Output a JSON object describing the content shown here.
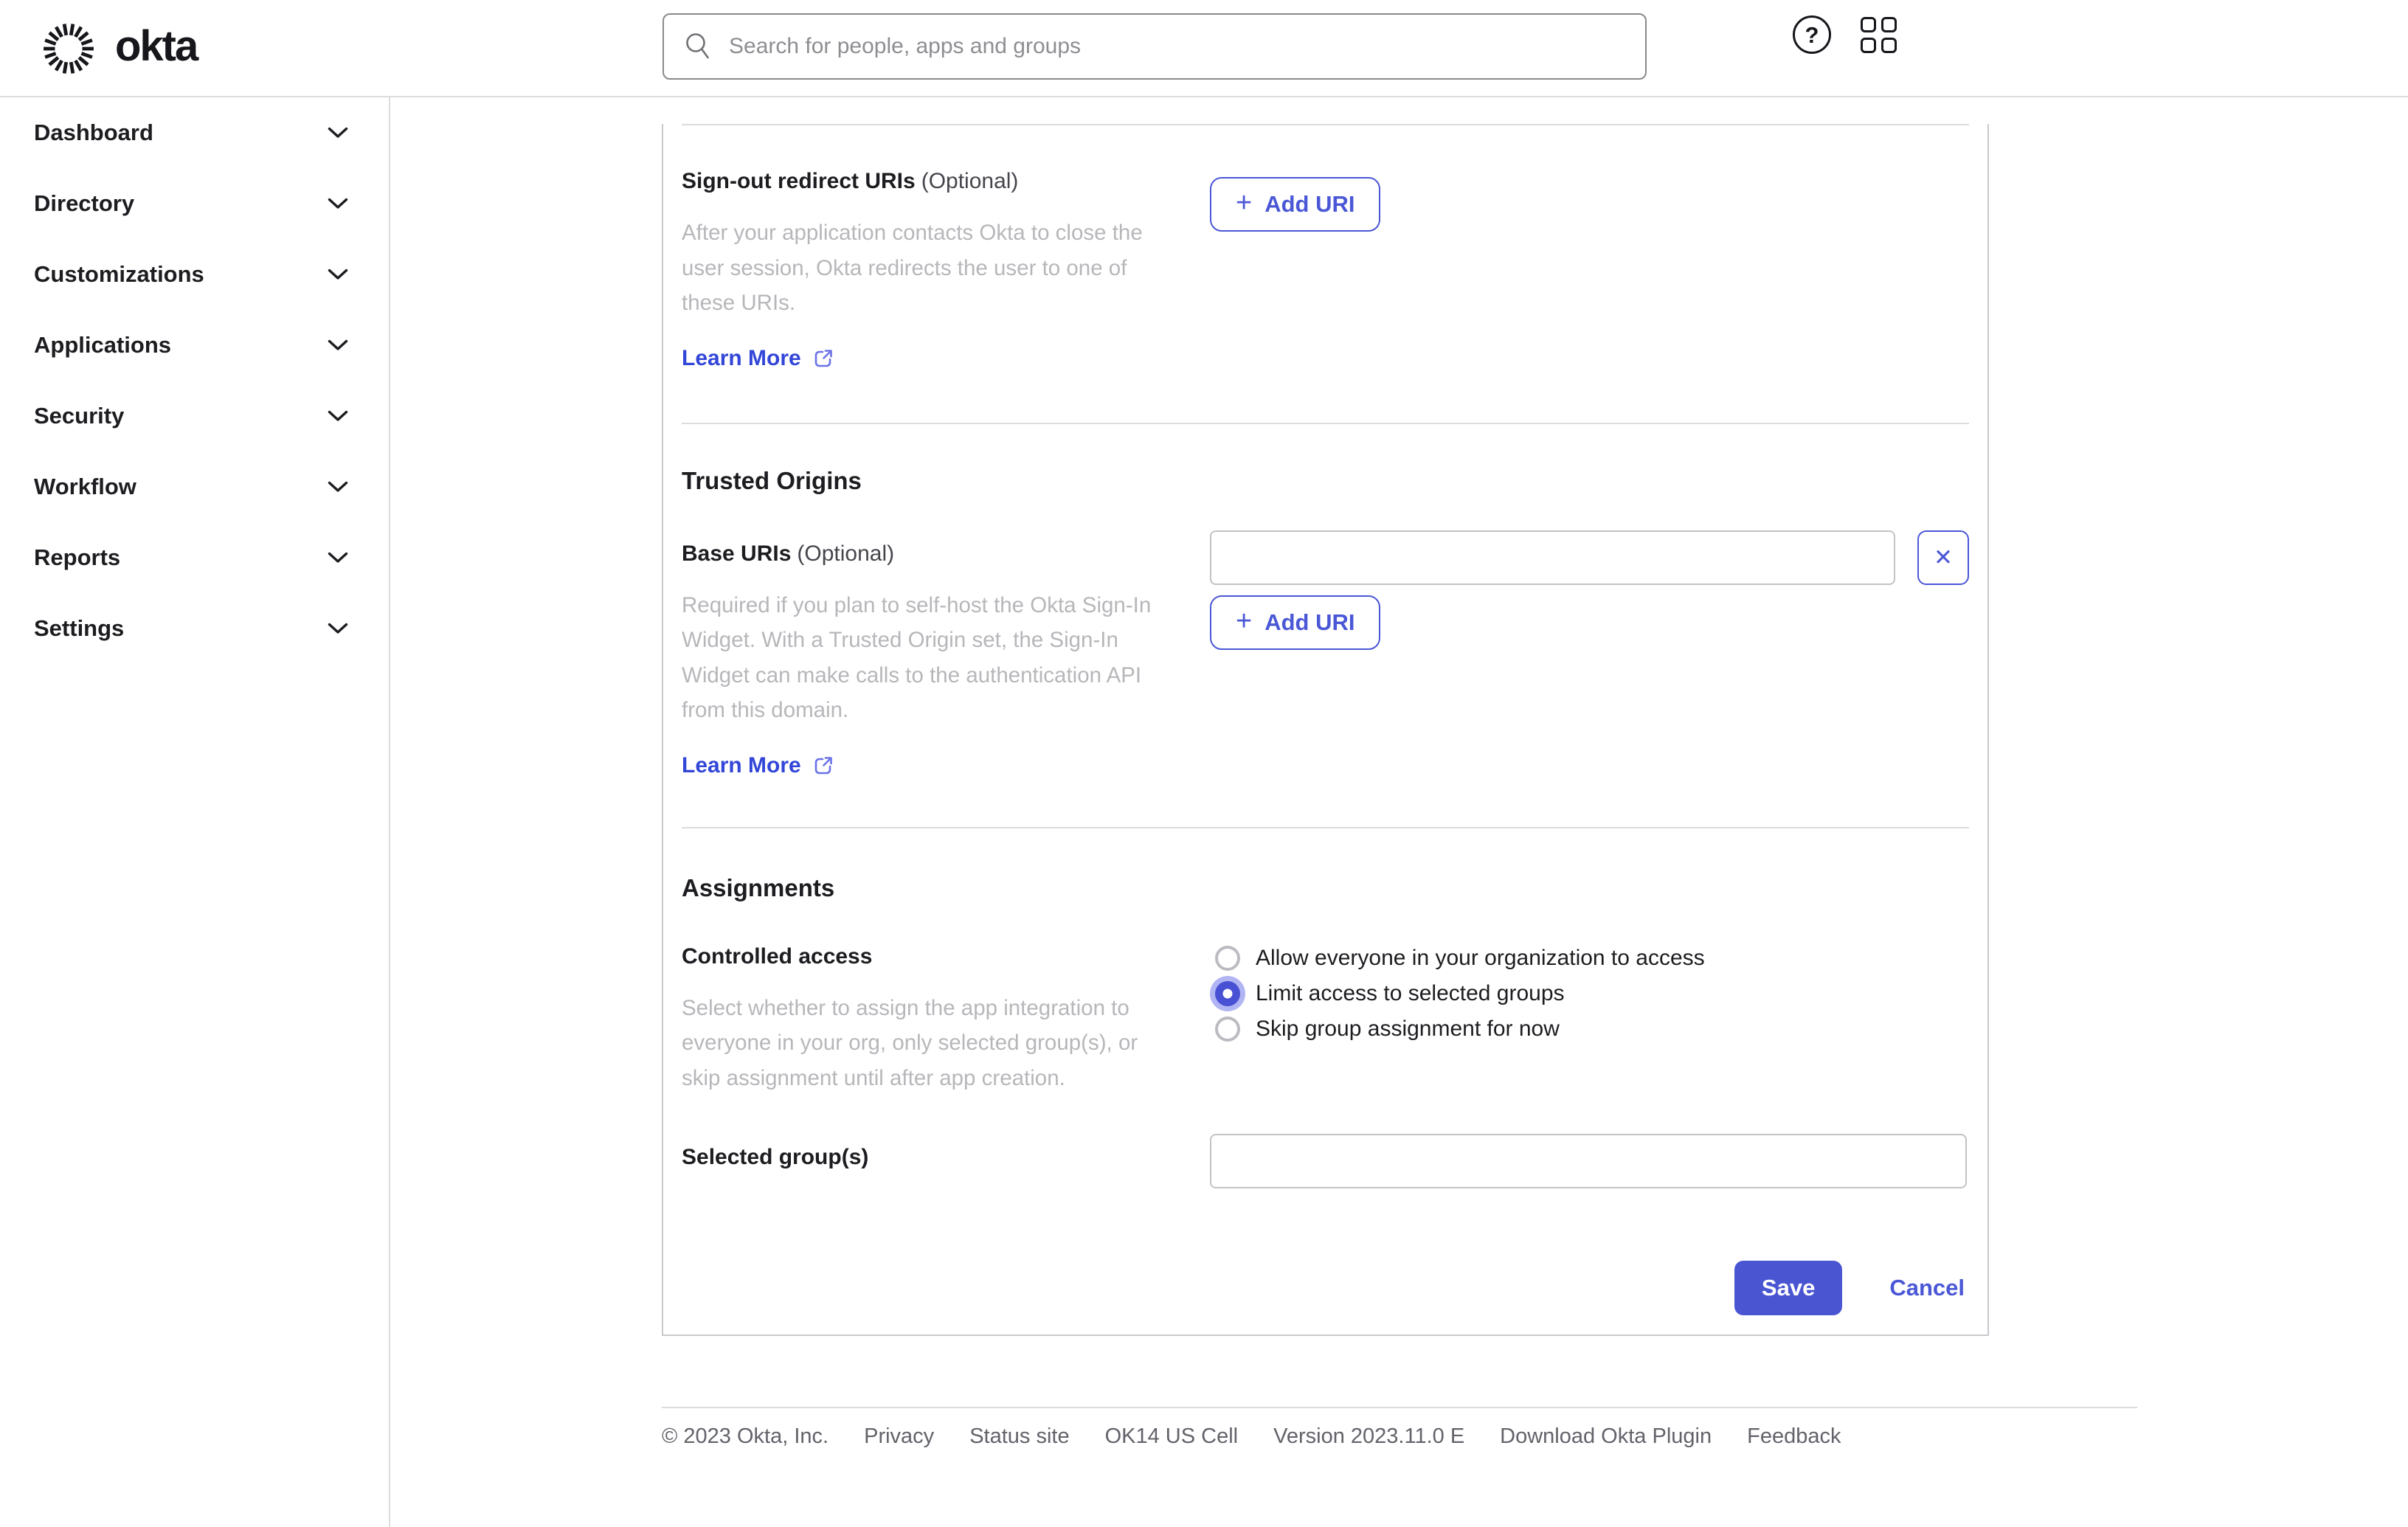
{
  "colors": {
    "primary_blue": "#4a57d6",
    "icon_blue": "#6b72e8",
    "save_fill": "#4a55d2",
    "radio_fill": "#4850d4",
    "text_dark": "#1d1d21",
    "text_gray": "#b7b7bb",
    "optional_gray": "#45454c",
    "footer_gray": "#62626a",
    "card_border": "#c9c9cd",
    "divider": "#dcdcde",
    "input_border": "#c3c3c7",
    "search_border": "#8a8a8e",
    "placeholder_gray": "#8e8e93"
  },
  "icons": {
    "plus": "+",
    "close": "✕",
    "question": "?"
  },
  "header": {
    "brand": "okta",
    "search": {
      "placeholder": "Search for people, apps and groups",
      "value": ""
    }
  },
  "sidebar": {
    "items": [
      {
        "label": "Dashboard"
      },
      {
        "label": "Directory"
      },
      {
        "label": "Customizations"
      },
      {
        "label": "Applications"
      },
      {
        "label": "Security"
      },
      {
        "label": "Workflow"
      },
      {
        "label": "Reports"
      },
      {
        "label": "Settings"
      }
    ]
  },
  "main": {
    "signout": {
      "label": "Sign-out redirect URIs",
      "optional": "(Optional)",
      "description": "After your application contacts Okta to close the user session, Okta redirects the user to one of these URIs.",
      "learn_more": "Learn More",
      "add_uri": "Add URI"
    },
    "trusted_origins": {
      "heading": "Trusted Origins",
      "label": "Base URIs",
      "optional": "(Optional)",
      "description": "Required if you plan to self-host the Okta Sign-In Widget. With a Trusted Origin set, the Sign-In Widget can make calls to the authentication API from this domain.",
      "learn_more": "Learn More",
      "add_uri": "Add URI",
      "input_value": ""
    },
    "assignments": {
      "heading": "Assignments",
      "controlled_access_label": "Controlled access",
      "controlled_access_description": "Select whether to assign the app integration to everyone in your org, only selected group(s), or skip assignment until after app creation.",
      "options": [
        {
          "label": "Allow everyone in your organization to access",
          "selected": false
        },
        {
          "label": "Limit access to selected groups",
          "selected": true
        },
        {
          "label": "Skip group assignment for now",
          "selected": false
        }
      ],
      "selected_groups_label": "Selected group(s)",
      "selected_groups_value": ""
    },
    "actions": {
      "save": "Save",
      "cancel": "Cancel"
    }
  },
  "footer": {
    "items": [
      {
        "label": "© 2023 Okta, Inc.",
        "link": false
      },
      {
        "label": "Privacy",
        "link": true
      },
      {
        "label": "Status site",
        "link": true
      },
      {
        "label": "OK14 US Cell",
        "link": false
      },
      {
        "label": "Version 2023.11.0 E",
        "link": false
      },
      {
        "label": "Download Okta Plugin",
        "link": true
      },
      {
        "label": "Feedback",
        "link": true
      }
    ]
  }
}
